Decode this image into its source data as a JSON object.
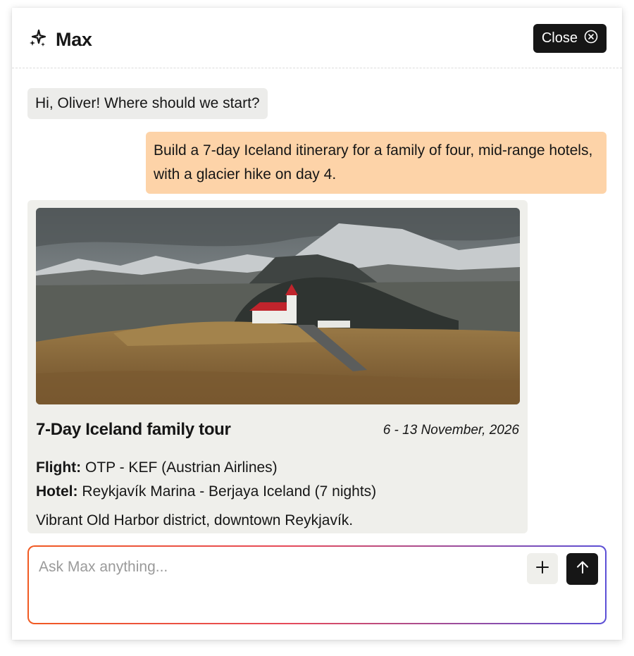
{
  "header": {
    "title": "Max",
    "close_label": "Close"
  },
  "messages": {
    "greeting": "Hi, Oliver! Where should we start?",
    "user_request": "Build a 7-day Iceland itinerary for a family of four, mid-range hotels, with a glacier hike on day 4."
  },
  "card": {
    "title": "7-Day Iceland family tour",
    "date": "6 - 13 November, 2026",
    "flight_label": "Flight:",
    "flight_value": "OTP - KEF (Austrian Airlines)",
    "hotel_label": "Hotel:",
    "hotel_value": "Reykjavík Marina - Berjaya Iceland (7 nights)",
    "description": "Vibrant Old Harbor district, downtown Reykjavík."
  },
  "composer": {
    "placeholder": "Ask Max anything..."
  },
  "icons": {
    "brand": "sparkles-icon",
    "close": "close-circle-icon",
    "add": "plus-icon",
    "send": "arrow-up-icon"
  },
  "colors": {
    "dark": "#161616",
    "user_bubble": "#fdd3a8",
    "ai_bubble": "#ececea",
    "card_bg": "#efefeb",
    "gradient_start": "#f15a22",
    "gradient_end": "#5b4fd6"
  }
}
